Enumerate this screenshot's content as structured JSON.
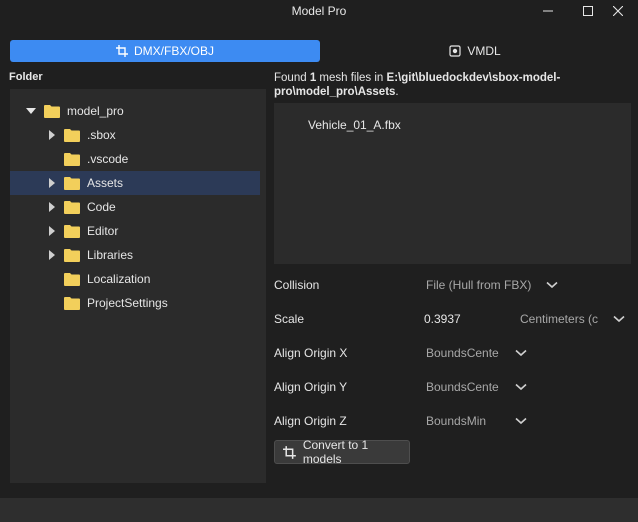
{
  "window": {
    "title": "Model Pro"
  },
  "tabs": [
    {
      "label": "DMX/FBX/OBJ",
      "icon": "crop-icon",
      "active": true
    },
    {
      "label": "VMDL",
      "icon": "model-icon",
      "active": false
    }
  ],
  "folder_panel": {
    "label": "Folder",
    "tree": [
      {
        "name": "model_pro",
        "expanded": true,
        "has_children": true,
        "level": 0
      },
      {
        "name": ".sbox",
        "has_children": true,
        "level": 1
      },
      {
        "name": ".vscode",
        "has_children": false,
        "level": 1
      },
      {
        "name": "Assets",
        "has_children": true,
        "level": 1,
        "selected": true
      },
      {
        "name": "Code",
        "has_children": true,
        "level": 1
      },
      {
        "name": "Editor",
        "has_children": true,
        "level": 1
      },
      {
        "name": "Libraries",
        "has_children": true,
        "level": 1
      },
      {
        "name": "Localization",
        "has_children": false,
        "level": 1
      },
      {
        "name": "ProjectSettings",
        "has_children": false,
        "level": 1
      }
    ]
  },
  "found": {
    "prefix": "Found ",
    "count": "1",
    "middle": " mesh files in ",
    "path": "E:\\git\\bluedockdev\\sbox-model-pro\\model_pro\\Assets",
    "suffix": "."
  },
  "mesh_files": [
    "Vehicle_01_A.fbx"
  ],
  "properties": {
    "collision": {
      "label": "Collision",
      "value": "File (Hull from FBX)"
    },
    "scale": {
      "label": "Scale",
      "value": "0.3937",
      "unit": "Centimeters (c"
    },
    "align_x": {
      "label": "Align Origin X",
      "value": "BoundsCente"
    },
    "align_y": {
      "label": "Align Origin Y",
      "value": "BoundsCente"
    },
    "align_z": {
      "label": "Align Origin Z",
      "value": "BoundsMin"
    }
  },
  "convert_button": {
    "label": "Convert to 1 models",
    "icon": "crop-icon"
  },
  "colors": {
    "accent": "#3d8bf2",
    "folder": "#f2cf5b",
    "selection": "#2c3a57"
  }
}
